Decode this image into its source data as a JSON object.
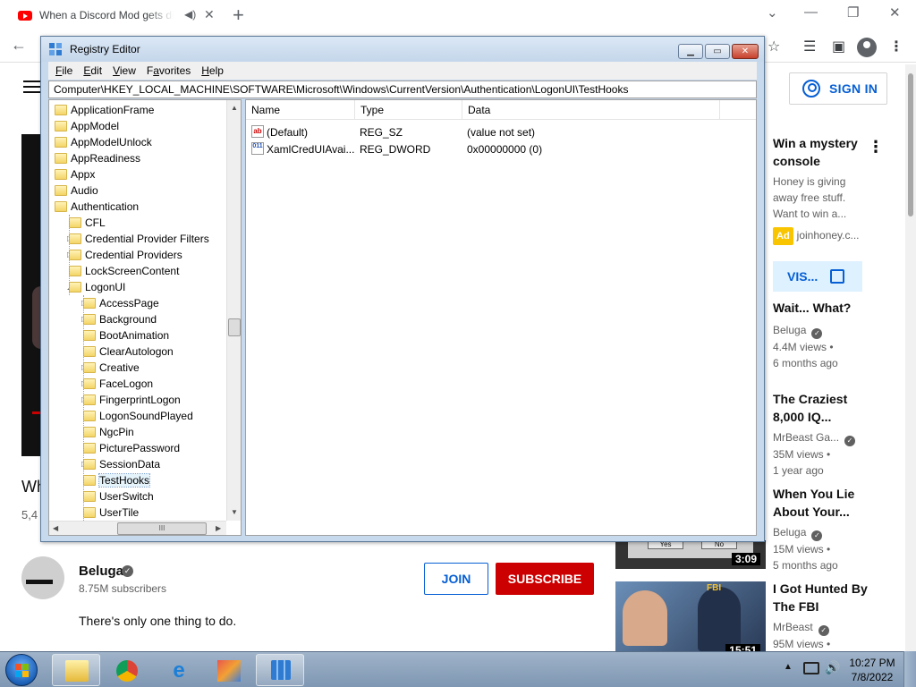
{
  "browser": {
    "tab_title": "When a Discord Mod gets di",
    "new_tab_glyph": "+",
    "minimize_glyph": "⌄",
    "restore_glyph": "❐",
    "close_glyph": "✕"
  },
  "youtube": {
    "sign_in_label": "SIGN IN",
    "title_fragment": "Wh",
    "views_fragment": "5,4",
    "channel": {
      "name": "Beluga",
      "subscribers": "8.75M subscribers",
      "join_label": "JOIN",
      "subscribe_label": "SUBSCRIBE"
    },
    "description": "There's only one thing to do.",
    "ad": {
      "title_line1": "Win a mystery",
      "title_line2": "console",
      "text_line1": "Honey is giving",
      "text_line2": "away free stuff.",
      "text_line3": "Want to win a...",
      "badge": "Ad",
      "domain": "joinhoney.c...",
      "visit_label": "VIS..."
    },
    "recommendations": [
      {
        "title_line1": "Wait... What?",
        "title_line2": "",
        "channel": "Beluga",
        "views": "4.4M views •",
        "age": "6 months ago"
      },
      {
        "title_line1": "The Craziest",
        "title_line2": "8,000 IQ...",
        "channel": "MrBeast Ga...",
        "views": "35M views •",
        "age": "1 year ago"
      },
      {
        "title_line1": "When You Lie",
        "title_line2": "About Your...",
        "channel": "Beluga",
        "views": "15M views •",
        "age": "5 months ago",
        "duration": "3:09",
        "thumb_text_yes": "Yes",
        "thumb_text_no": "No"
      },
      {
        "title_line1": "I Got Hunted By",
        "title_line2": "The FBI",
        "channel": "MrBeast",
        "views": "95M views •",
        "age": "",
        "duration": "15:51",
        "thumb_badge": "FBI"
      }
    ]
  },
  "regedit": {
    "title": "Registry Editor",
    "menu": [
      "File",
      "Edit",
      "View",
      "Favorites",
      "Help"
    ],
    "menu_accel": [
      "F",
      "E",
      "V",
      "a",
      "H"
    ],
    "address": "Computer\\HKEY_LOCAL_MACHINE\\SOFTWARE\\Microsoft\\Windows\\CurrentVersion\\Authentication\\LogonUI\\TestHooks",
    "tree": [
      {
        "label": "ApplicationFrame",
        "level": 0
      },
      {
        "label": "AppModel",
        "level": 0
      },
      {
        "label": "AppModelUnlock",
        "level": 0
      },
      {
        "label": "AppReadiness",
        "level": 0
      },
      {
        "label": "Appx",
        "level": 0
      },
      {
        "label": "Audio",
        "level": 0
      },
      {
        "label": "Authentication",
        "level": 0
      },
      {
        "label": "CFL",
        "level": 1
      },
      {
        "label": "Credential Provider Filters",
        "level": 1,
        "expand": "▷"
      },
      {
        "label": "Credential Providers",
        "level": 1,
        "expand": "▷"
      },
      {
        "label": "LockScreenContent",
        "level": 1
      },
      {
        "label": "LogonUI",
        "level": 1,
        "expand": "◢"
      },
      {
        "label": "AccessPage",
        "level": 2,
        "expand": "▷"
      },
      {
        "label": "Background",
        "level": 2,
        "expand": "▷"
      },
      {
        "label": "BootAnimation",
        "level": 2
      },
      {
        "label": "ClearAutologon",
        "level": 2
      },
      {
        "label": "Creative",
        "level": 2,
        "expand": "▷"
      },
      {
        "label": "FaceLogon",
        "level": 2,
        "expand": "▷"
      },
      {
        "label": "FingerprintLogon",
        "level": 2,
        "expand": "▷"
      },
      {
        "label": "LogonSoundPlayed",
        "level": 2
      },
      {
        "label": "NgcPin",
        "level": 2
      },
      {
        "label": "PicturePassword",
        "level": 2
      },
      {
        "label": "SessionData",
        "level": 2,
        "expand": "▷"
      },
      {
        "label": "TestHooks",
        "level": 2,
        "selected": true
      },
      {
        "label": "UserSwitch",
        "level": 2
      },
      {
        "label": "UserTile",
        "level": 2
      }
    ],
    "columns": [
      "Name",
      "Type",
      "Data"
    ],
    "values": [
      {
        "name": "(Default)",
        "type": "REG_SZ",
        "data": "(value not set)",
        "icon": "string-value-icon",
        "icon_text": "ab"
      },
      {
        "name": "XamlCredUIAvai...",
        "type": "REG_DWORD",
        "data": "0x00000000 (0)",
        "icon": "binary-value-icon",
        "icon_text": "011"
      }
    ],
    "hscroll_grip": "III"
  },
  "taskbar": {
    "time": "10:27 PM",
    "date": "7/8/2022",
    "tray_up_glyph": "▲",
    "volume_glyph": "🔊"
  }
}
